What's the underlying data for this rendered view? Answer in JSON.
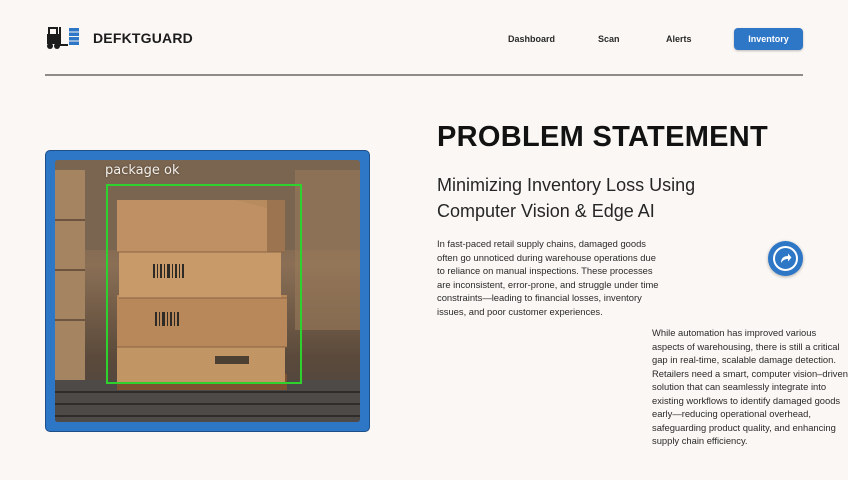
{
  "header": {
    "brand_name": "DEFKTGUARD",
    "logo_icon": "forklift-icon",
    "nav": {
      "dashboard": "Dashboard",
      "scan": "Scan",
      "alerts": "Alerts",
      "inventory": "Inventory"
    }
  },
  "detection": {
    "label": "package ok",
    "box_color": "#2fd12f"
  },
  "content": {
    "title": "PROBLEM STATEMENT",
    "subtitle": "Minimizing Inventory Loss Using Computer Vision & Edge AI",
    "paragraph1": "In fast-paced retail supply chains, damaged goods often go unnoticed during warehouse operations due to reliance on manual inspections. These processes are inconsistent, error-prone, and struggle under time constraints—leading to financial losses, inventory issues, and poor customer experiences.",
    "paragraph2": "While automation has improved various aspects of warehousing, there is still a critical gap in real-time, scalable damage detection. Retailers need a smart, computer vision–driven solution that can seamlessly integrate into existing workflows to identify damaged goods early—reducing operational overhead, safeguarding product quality, and enhancing supply chain efficiency."
  },
  "share_icon": "share-arrow-icon",
  "colors": {
    "accent": "#2e76c6",
    "background": "#fbf7f4"
  }
}
